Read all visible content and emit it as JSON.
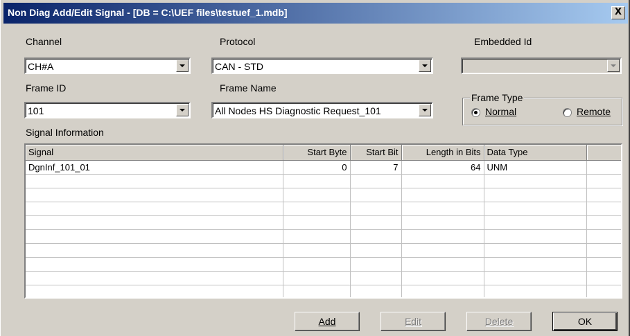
{
  "window": {
    "title": "Non Diag Add/Edit Signal - [DB = C:\\UEF files\\testuef_1.mdb]",
    "close_label": "X"
  },
  "channel": {
    "label": "Channel",
    "value": "CH#A"
  },
  "protocol": {
    "label": "Protocol",
    "value": "CAN - STD"
  },
  "embedded_id": {
    "label": "Embedded Id",
    "value": ""
  },
  "frame_id": {
    "label": "Frame ID",
    "value": "101"
  },
  "frame_name": {
    "label": "Frame Name",
    "value": "All Nodes HS Diagnostic Request_101"
  },
  "frame_type": {
    "label": "Frame Type",
    "normal_label": "Normal",
    "remote_label": "Remote",
    "selected": "Normal"
  },
  "signal_info": {
    "label": "Signal Information",
    "columns": [
      "Signal",
      "Start Byte",
      "Start Bit",
      "Length in Bits",
      "Data Type",
      ""
    ],
    "rows": [
      [
        "DgnInf_101_01",
        "0",
        "7",
        "64",
        "UNM",
        ""
      ]
    ]
  },
  "buttons": {
    "add": "Add",
    "edit": "Edit",
    "delete": "Delete",
    "ok": "OK"
  }
}
